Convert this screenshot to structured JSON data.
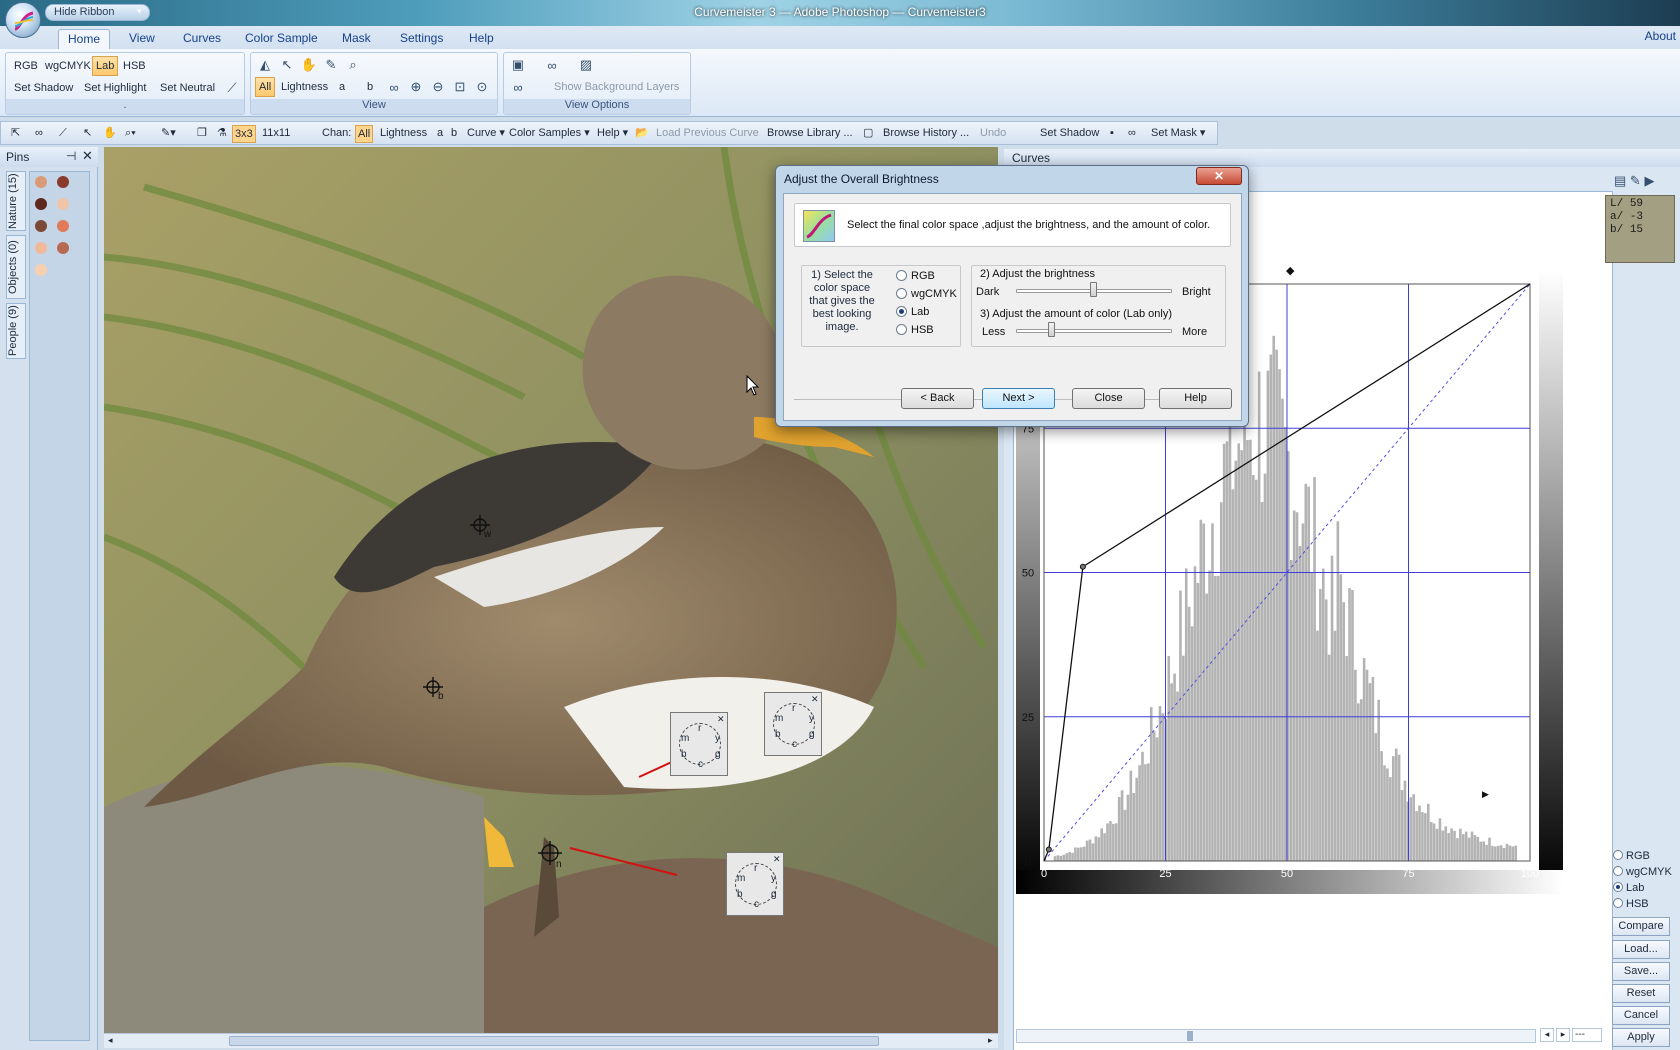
{
  "window": {
    "title": "Curvemeister 3 — Adobe Photoshop — Curvemeister3",
    "hide_ribbon_label": "Hide Ribbon"
  },
  "ribbon": {
    "tabs": [
      {
        "label": "Home",
        "active": true
      },
      {
        "label": "View"
      },
      {
        "label": "Curves"
      },
      {
        "label": "Color Sample"
      },
      {
        "label": "Mask"
      },
      {
        "label": "Settings"
      },
      {
        "label": "Help"
      }
    ],
    "about_label": "About",
    "colorspace_group": {
      "modes": [
        "RGB",
        "wgCMYK",
        "Lab",
        "HSB"
      ],
      "active_mode": "Lab",
      "set_shadow": "Set Shadow",
      "set_highlight": "Set Highlight",
      "set_neutral": "Set Neutral",
      "caption": "."
    },
    "view_group": {
      "channels": [
        "All",
        "Lightness",
        "a",
        "b"
      ],
      "active_channel": "All",
      "caption": "View"
    },
    "view_options_group": {
      "show_background_layers": "Show Background Layers",
      "caption": "View Options"
    }
  },
  "toolbar": {
    "grid_3x3": "3x3",
    "grid_11x11": "11x11",
    "chan_label": "Chan:",
    "channels": [
      "All",
      "Lightness",
      "a",
      "b"
    ],
    "curve_menu": "Curve",
    "color_samples_menu": "Color Samples",
    "help_menu": "Help",
    "load_previous_curve": "Load Previous Curve",
    "browse_library": "Browse Library ...",
    "browse_history": "Browse History ...",
    "undo": "Undo",
    "set_shadow": "Set Shadow",
    "set_mask": "Set Mask"
  },
  "pins_panel": {
    "title": "Pins",
    "tabs": [
      "Nature (15)",
      "Objects (0)",
      "People (9)"
    ]
  },
  "photo": {
    "pin_labels": [
      "w",
      "b",
      "n"
    ],
    "sampler_letters": [
      "r",
      "y",
      "g",
      "c",
      "b",
      "m"
    ]
  },
  "curves_panel": {
    "title": "Curves",
    "readout": {
      "L": "59",
      "a": "-3",
      "b": "15"
    },
    "colorspace_options": [
      "RGB",
      "wgCMYK",
      "Lab",
      "HSB"
    ],
    "selected_colorspace": "Lab",
    "buttons": [
      "Compare",
      "Load...",
      "Save...",
      "Reset",
      "Cancel",
      "Apply"
    ],
    "zoom_value": "---"
  },
  "chart_data": {
    "type": "line",
    "x_ticks": [
      0,
      25,
      50,
      75,
      100
    ],
    "y_ticks": [
      0,
      25,
      50,
      75
    ],
    "xlim": [
      0,
      100
    ],
    "ylim": [
      0,
      100
    ],
    "grid": true,
    "series": [
      {
        "points": [
          [
            0,
            0
          ],
          [
            1,
            2
          ],
          [
            8,
            51
          ],
          [
            100,
            100
          ]
        ]
      },
      {
        "points": [
          [
            0,
            0
          ],
          [
            100,
            100
          ]
        ]
      }
    ],
    "histogram_shape": "bell centered near 45, long right tail"
  },
  "dialog": {
    "title": "Adjust the Overall Brightness",
    "intro": "Select the final color space ,adjust the brightness, and the amount of color.",
    "step1": [
      "1) Select the",
      "color space",
      "that gives the",
      "best looking",
      "image."
    ],
    "colorspace_options": [
      "RGB",
      "wgCMYK",
      "Lab",
      "HSB"
    ],
    "selected_colorspace": "Lab",
    "step2": "2) Adjust the brightness",
    "dark_label": "Dark",
    "bright_label": "Bright",
    "brightness_level": 0.5,
    "step3": "3) Adjust the amount of color (Lab only)",
    "less_label": "Less",
    "more_label": "More",
    "color_level": 0.22,
    "buttons": {
      "back": "< Back",
      "next": "Next >",
      "close": "Close",
      "help": "Help"
    },
    "close_glyph": "✕"
  }
}
